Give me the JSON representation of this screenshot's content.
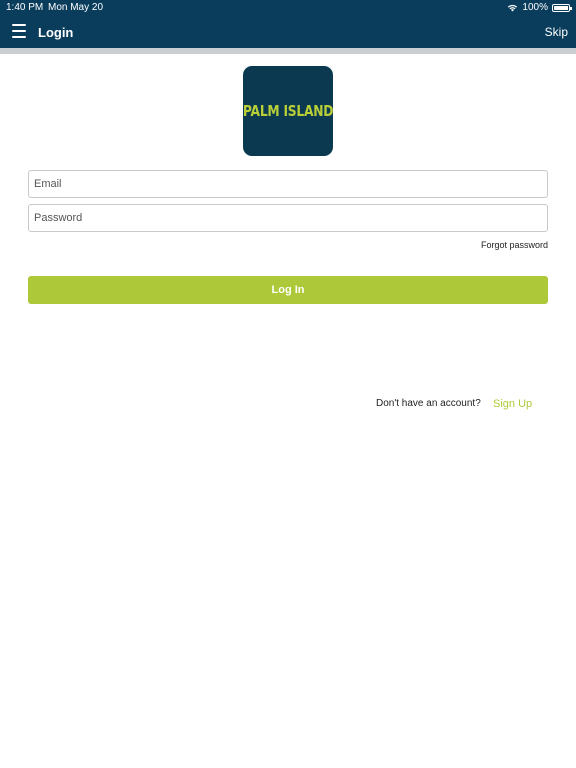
{
  "status_bar": {
    "time": "1:40 PM",
    "date": "Mon May 20",
    "battery_text": "100%",
    "battery_level": 1.0,
    "wifi_icon": "wifi-icon",
    "battery_icon": "battery-icon"
  },
  "nav": {
    "menu_icon": "hamburger-menu-icon",
    "title": "Login",
    "skip_label": "Skip"
  },
  "logo": {
    "text": "PALM ISLAND"
  },
  "form": {
    "email_placeholder": "Email",
    "email_value": "",
    "password_placeholder": "Password",
    "password_value": "",
    "forgot_label": "Forgot password",
    "login_label": "Log In"
  },
  "signup": {
    "prompt": "Don't have an account?",
    "link_label": "Sign Up"
  },
  "colors": {
    "header": "#0a3d5c",
    "logo_bg": "#0b3a50",
    "accent": "#adc93a",
    "divider": "#c9ced3"
  }
}
